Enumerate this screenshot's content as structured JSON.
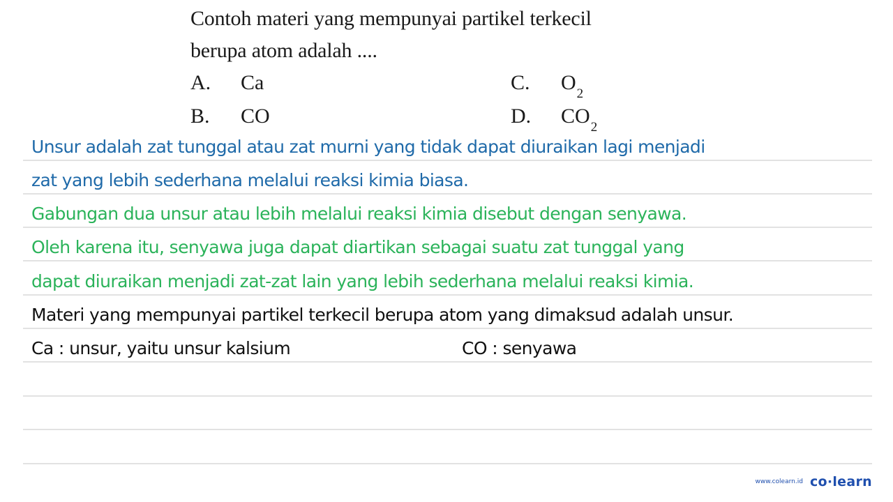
{
  "question": {
    "line1": "Contoh materi yang mempunyai partikel terkecil",
    "line2": "berupa atom adalah ....",
    "options": [
      {
        "label": "A.",
        "formula": "Ca",
        "subscript": ""
      },
      {
        "label": "B.",
        "formula": "CO",
        "subscript": ""
      },
      {
        "label": "C.",
        "formula": "O",
        "subscript": "2"
      },
      {
        "label": "D.",
        "formula": "CO",
        "subscript": "2"
      }
    ]
  },
  "answer": {
    "lines": [
      "Unsur adalah zat tunggal atau zat murni yang tidak dapat diuraikan lagi menjadi",
      "zat yang lebih sederhana melalui reaksi kimia biasa.",
      "Gabungan dua unsur atau lebih melalui reaksi kimia disebut dengan senyawa.",
      "Oleh karena itu, senyawa juga dapat diartikan sebagai suatu zat tunggal yang",
      "dapat diuraikan menjadi zat-zat lain yang lebih sederhana melalui reaksi kimia.",
      "Materi yang mempunyai partikel terkecil berupa atom yang dimaksud adalah unsur.",
      "Ca : unsur, yaitu unsur kalsium",
      "CO : senyawa"
    ],
    "colors": {
      "definition": "#1f6aa9",
      "compound": "#2bb35a",
      "conclusion": "#111111"
    }
  },
  "footer": {
    "url": "www.colearn.id",
    "brand": "co·learn"
  }
}
